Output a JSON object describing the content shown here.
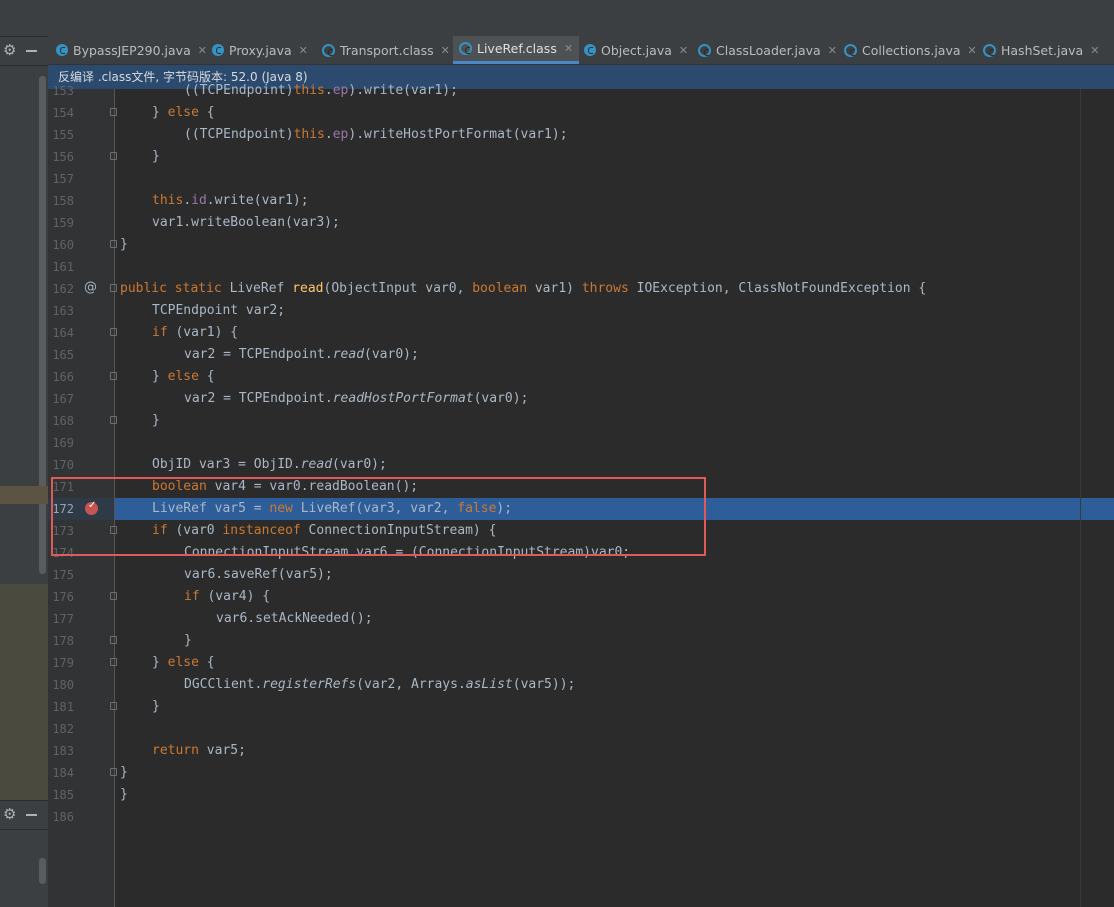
{
  "tabs": [
    {
      "label": "BypassJEP290.java",
      "active": false,
      "icon": "java-class-icon"
    },
    {
      "label": "Proxy.java",
      "active": false,
      "icon": "java-class-icon"
    },
    {
      "label": "Transport.class",
      "active": false,
      "icon": "compiled-class-icon"
    },
    {
      "label": "LiveRef.class",
      "active": true,
      "icon": "compiled-class-icon"
    },
    {
      "label": "Object.java",
      "active": false,
      "icon": "java-class-icon"
    },
    {
      "label": "ClassLoader.java",
      "active": false,
      "icon": "compiled-class-icon"
    },
    {
      "label": "Collections.java",
      "active": false,
      "icon": "compiled-class-icon"
    },
    {
      "label": "HashSet.java",
      "active": false,
      "icon": "compiled-class-icon"
    }
  ],
  "banner": "反编译 .class文件, 字节码版本: 52.0 (Java 8)",
  "editor": {
    "line_numbers": [
      "153",
      "154",
      "155",
      "156",
      "157",
      "158",
      "159",
      "160",
      "161",
      "162",
      "163",
      "164",
      "165",
      "166",
      "167",
      "168",
      "169",
      "170",
      "171",
      "172",
      "173",
      "174",
      "175",
      "176",
      "177",
      "178",
      "179",
      "180",
      "181",
      "182",
      "183",
      "184",
      "185",
      "186"
    ],
    "current_line": "172",
    "breakpoint_line": "172",
    "override_marker_line": "162",
    "override_marker": "@"
  },
  "code": {
    "l153a": "        ((",
    "l153b": "TCPEndpoint",
    "l153c": ")",
    "l153d": "this",
    "l153e": ".",
    "l153f": "ep",
    "l153g": ").write(var1);",
    "l154a": "    } ",
    "l154b": "else",
    "l154c": " {",
    "l155a": "        ((TCPEndpoint)",
    "l155b": "this",
    "l155c": ".",
    "l155d": "ep",
    "l155e": ").writeHostPortFormat(var1);",
    "l156a": "    }",
    "l158a": "    ",
    "l158b": "this",
    "l158c": ".",
    "l158d": "id",
    "l158e": ".write(var1);",
    "l159a": "    var1.writeBoolean(var3);",
    "l160a": "}",
    "l162a": "public static ",
    "l162b": "LiveRef ",
    "l162c": "read",
    "l162d": "(ObjectInput var0, ",
    "l162e": "boolean",
    "l162f": " var1) ",
    "l162g": "throws",
    "l162h": " IOException, ClassNotFoundException {",
    "l163a": "    TCPEndpoint var2;",
    "l164a": "    ",
    "l164b": "if",
    "l164c": " (var1) {",
    "l165a": "        var2 = TCPEndpoint.",
    "l165b": "read",
    "l165c": "(var0);",
    "l166a": "    } ",
    "l166b": "else",
    "l166c": " {",
    "l167a": "        var2 = TCPEndpoint.",
    "l167b": "readHostPortFormat",
    "l167c": "(var0);",
    "l168a": "    }",
    "l170a": "    ObjID var3 = ObjID.",
    "l170b": "read",
    "l170c": "(var0);",
    "l171a": "    ",
    "l171b": "boolean",
    "l171c": " var4 = var0.readBoolean();",
    "l172a": "    LiveRef var5 = ",
    "l172b": "new",
    "l172c": " LiveRef(var3, var2, ",
    "l172d": "false",
    "l172e": ");",
    "l173a": "    ",
    "l173b": "if",
    "l173c": " (var0 ",
    "l173d": "instanceof",
    "l173e": " ConnectionInputStream) {",
    "l174a": "        ConnectionInputStream var6 = (ConnectionInputStream)var0;",
    "l175a": "        var6.saveRef(var5);",
    "l176a": "        ",
    "l176b": "if",
    "l176c": " (var4) {",
    "l177a": "            var6.setAckNeeded();",
    "l178a": "        }",
    "l179a": "    } ",
    "l179b": "else",
    "l179c": " {",
    "l180a": "        DGCClient.",
    "l180b": "registerRefs",
    "l180c": "(var2, Arrays.",
    "l180d": "asList",
    "l180e": "(var5));",
    "l181a": "    }",
    "l183a": "    ",
    "l183b": "return",
    "l183c": " var5;",
    "l184a": "}",
    "l185a": "}"
  },
  "colors": {
    "keyword": "#cc7832",
    "method_decl": "#ffc66d",
    "field": "#9876aa",
    "text": "#a9b7c6",
    "exec_line": "#2d5e9a",
    "highlight_box": "#e05a5a",
    "banner_bg": "#2b4a6e"
  }
}
